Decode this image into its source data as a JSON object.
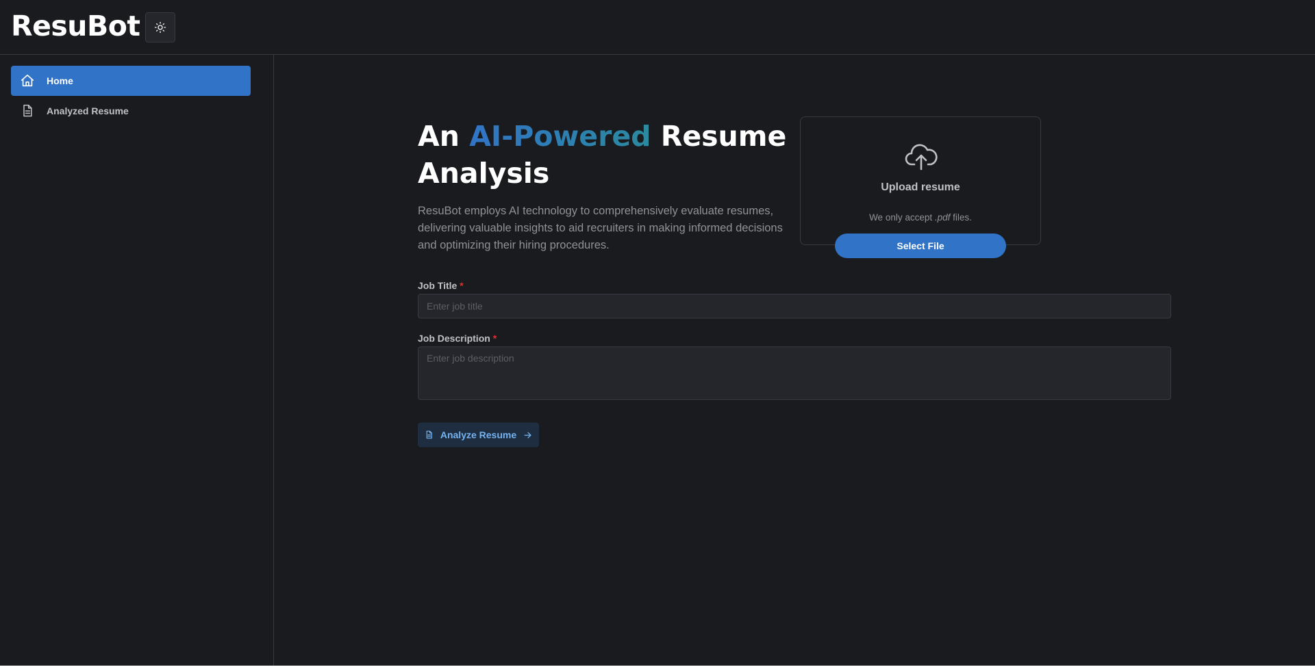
{
  "app": {
    "logo": "ResuBot",
    "theme_toggle_icon": "sun-icon"
  },
  "sidebar": {
    "items": [
      {
        "label": "Home",
        "icon": "home-icon",
        "active": true
      },
      {
        "label": "Analyzed Resume",
        "icon": "document-icon",
        "active": false
      }
    ]
  },
  "hero": {
    "title_part1": "An ",
    "title_accent": "AI-Powered",
    "title_part2": " Resume Analysis",
    "description": "ResuBot employs AI technology to comprehensively evaluate resumes, delivering valuable insights to aid recruiters in making informed decisions and optimizing their hiring procedures."
  },
  "upload": {
    "icon": "cloud-upload-icon",
    "title": "Upload resume",
    "note_before": "We only accept ",
    "note_ext": ".pdf",
    "note_after": " files.",
    "button_label": "Select File"
  },
  "form": {
    "job_title_label": "Job Title",
    "job_title_placeholder": "Enter job title",
    "job_title_value": "",
    "job_description_label": "Job Description",
    "job_description_placeholder": "Enter job description",
    "job_description_value": "",
    "required_mark": "*",
    "analyze_label": "Analyze Resume"
  },
  "colors": {
    "background": "#1a1b1e",
    "accent": "#3174c7",
    "border": "#373a40",
    "required": "#e03131"
  }
}
